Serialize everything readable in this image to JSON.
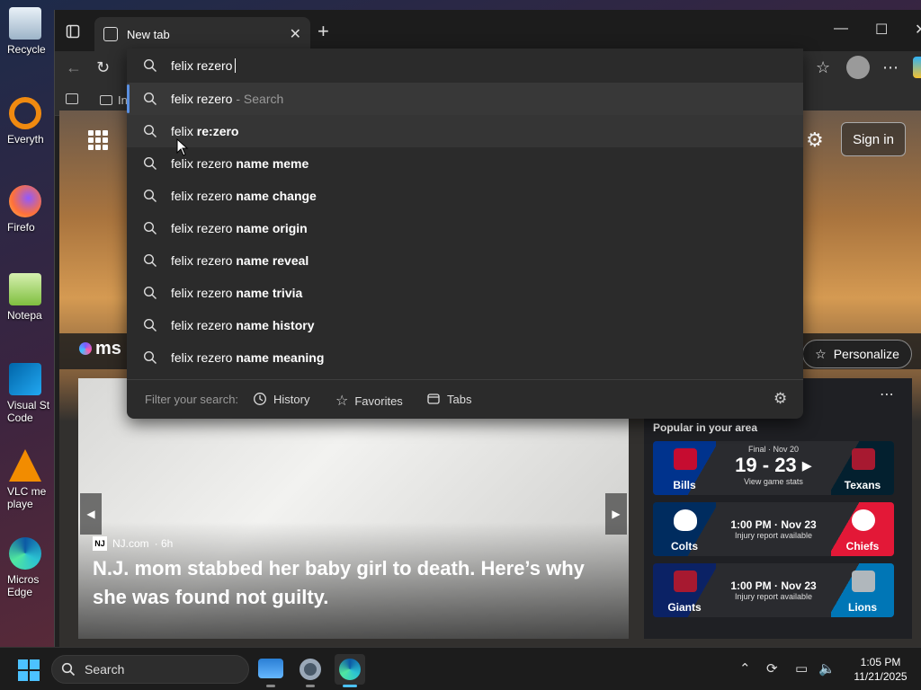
{
  "desktop": {
    "icons": [
      {
        "label": "Recycle",
        "icon": "recycle-bin-icon"
      },
      {
        "label": "Everyth",
        "icon": "everything-search-icon"
      },
      {
        "label": "Firefo",
        "icon": "firefox-icon"
      },
      {
        "label": "Notepa",
        "icon": "notepad-plus-icon"
      },
      {
        "label": "Visual St Code",
        "icon": "vscode-icon"
      },
      {
        "label": "VLC me playe",
        "icon": "vlc-icon"
      },
      {
        "label": "Micros Edge",
        "icon": "edge-icon"
      }
    ]
  },
  "browser": {
    "tab_title": "New tab",
    "favbar_item": "In",
    "omnibox_value": "felix rezero",
    "suggestions": [
      {
        "typed": "felix rezero",
        "bold": "",
        "hint": " - Search"
      },
      {
        "typed": "felix ",
        "bold": "re:zero",
        "hint": ""
      },
      {
        "typed": "felix rezero ",
        "bold": "name meme",
        "hint": ""
      },
      {
        "typed": "felix rezero ",
        "bold": "name change",
        "hint": ""
      },
      {
        "typed": "felix rezero ",
        "bold": "name origin",
        "hint": ""
      },
      {
        "typed": "felix rezero ",
        "bold": "name reveal",
        "hint": ""
      },
      {
        "typed": "felix rezero ",
        "bold": "name trivia",
        "hint": ""
      },
      {
        "typed": "felix rezero ",
        "bold": "name history",
        "hint": ""
      },
      {
        "typed": "felix rezero ",
        "bold": "name meaning",
        "hint": ""
      }
    ],
    "filter_label": "Filter your search:",
    "filter_history": "History",
    "filter_favorites": "Favorites",
    "filter_tabs": "Tabs"
  },
  "newtab": {
    "sign_in": "Sign in",
    "msn_logo": "ms",
    "personalize": "Personalize",
    "news": {
      "source": "NJ.com",
      "age": "· 6h",
      "source_badge": "NJ",
      "title": "N.J. mom stabbed her baby girl to death. Here’s why she was found not guilty."
    },
    "popular_title": "Popular in your area",
    "games": [
      {
        "home": "Bills",
        "away": "Texans",
        "line1": "Final · Nov 20",
        "score": "19 - 23 ▸",
        "line2": "View game stats",
        "home_color": "#00338d",
        "away_color": "#03202f"
      },
      {
        "home": "Colts",
        "away": "Chiefs",
        "line1": "",
        "score": "1:00 PM · Nov 23",
        "line2": "Injury report available",
        "home_color": "#002c5f",
        "away_color": "#e31837"
      },
      {
        "home": "Giants",
        "away": "Lions",
        "line1": "",
        "score": "1:00 PM · Nov 23",
        "line2": "Injury report available",
        "home_color": "#0b2265",
        "away_color": "#0076b6"
      }
    ]
  },
  "taskbar": {
    "search_label": "Search",
    "time": "1:05 PM",
    "date": "11/21/2025"
  },
  "colors": {
    "accent": "#5a8fe0",
    "windows_blue": "#4cc2ff"
  }
}
